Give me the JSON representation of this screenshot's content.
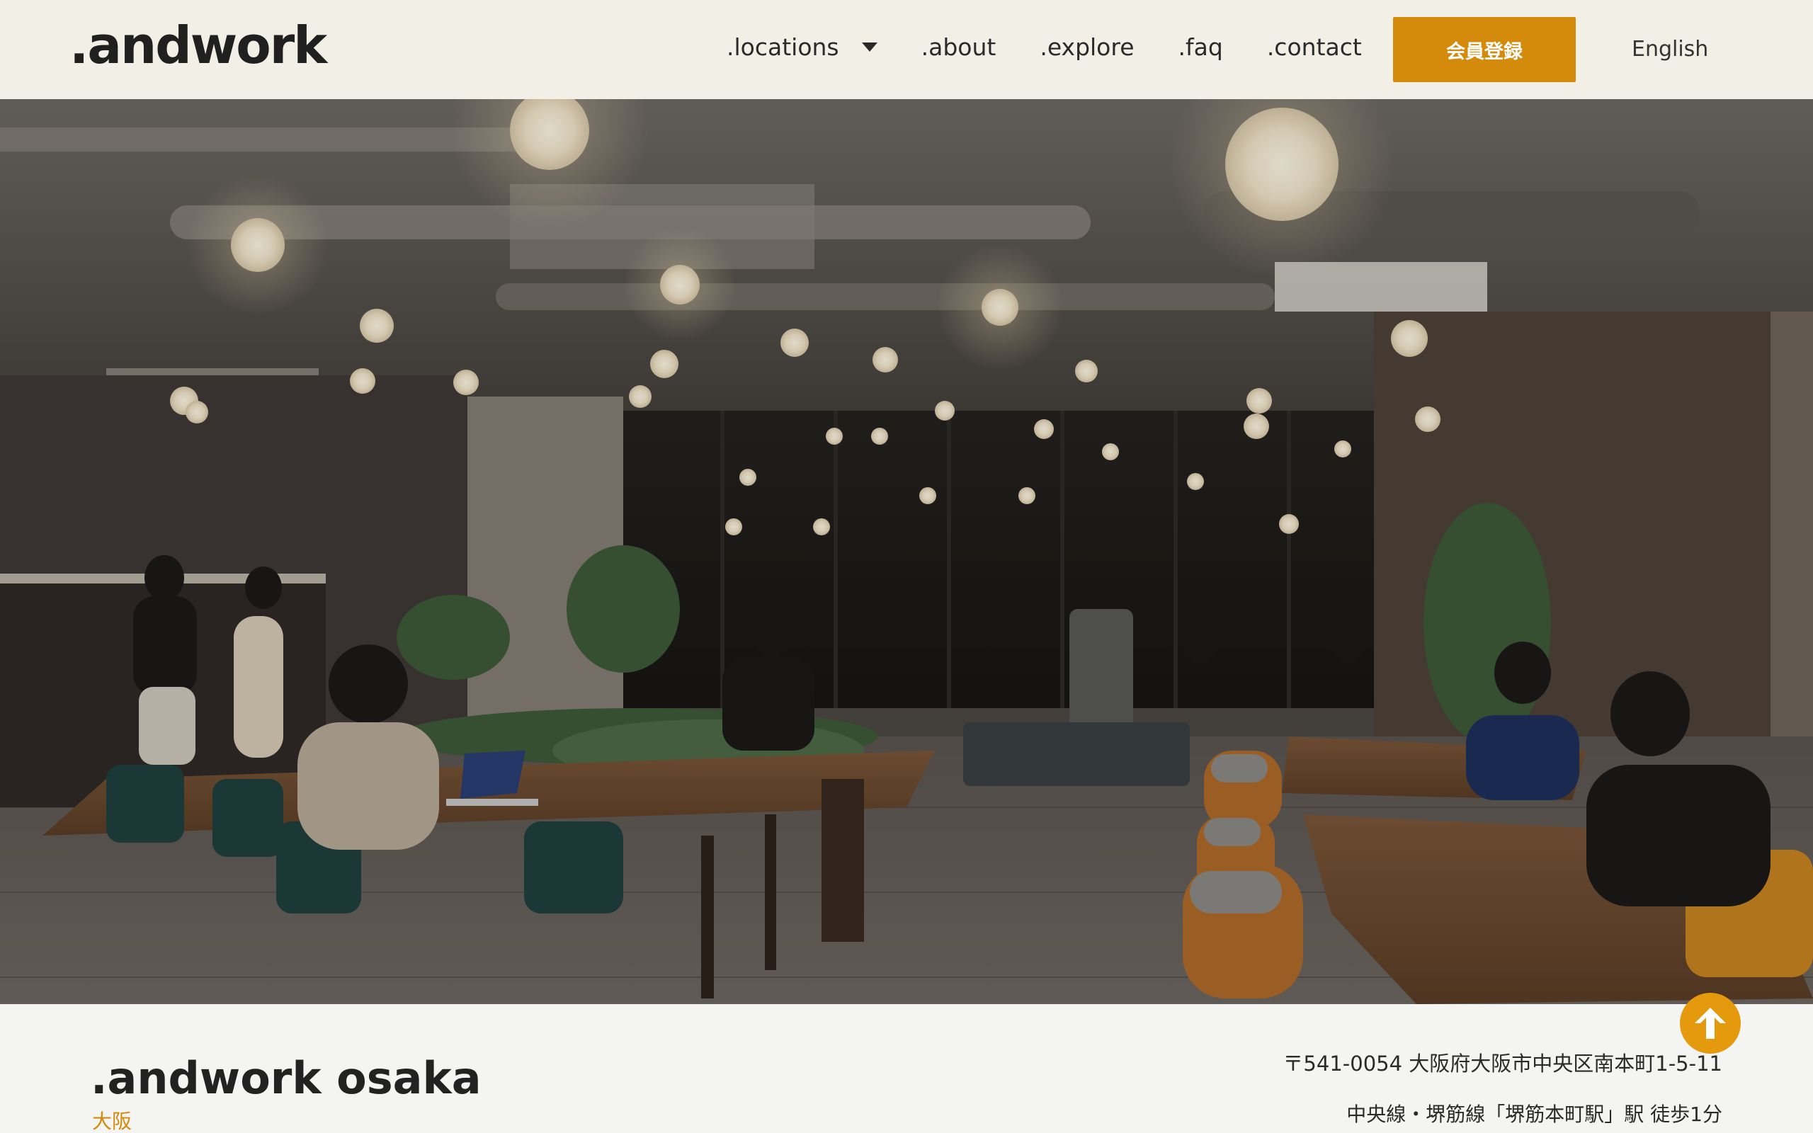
{
  "header": {
    "logo": ".andwork",
    "nav": [
      {
        "label": ".locations",
        "has_dropdown": true
      },
      {
        "label": ".about"
      },
      {
        "label": ".explore"
      },
      {
        "label": ".faq"
      },
      {
        "label": ".contact"
      }
    ],
    "signup_label": "会員登録",
    "language_label": "English"
  },
  "location": {
    "name": ".andwork osaka",
    "city": "大阪",
    "address": "〒541-0054 大阪府大阪市中央区南本町1-5-11",
    "access": "中央線・堺筋線「堺筋本町駅」駅 徒歩1分"
  },
  "colors": {
    "header_bg": "#f2efe6",
    "accent": "#d48a0a",
    "back_to_top": "#e59a0e"
  },
  "icons": {
    "dropdown": "chevron-down-icon",
    "back_to_top": "arrow-up-icon"
  }
}
